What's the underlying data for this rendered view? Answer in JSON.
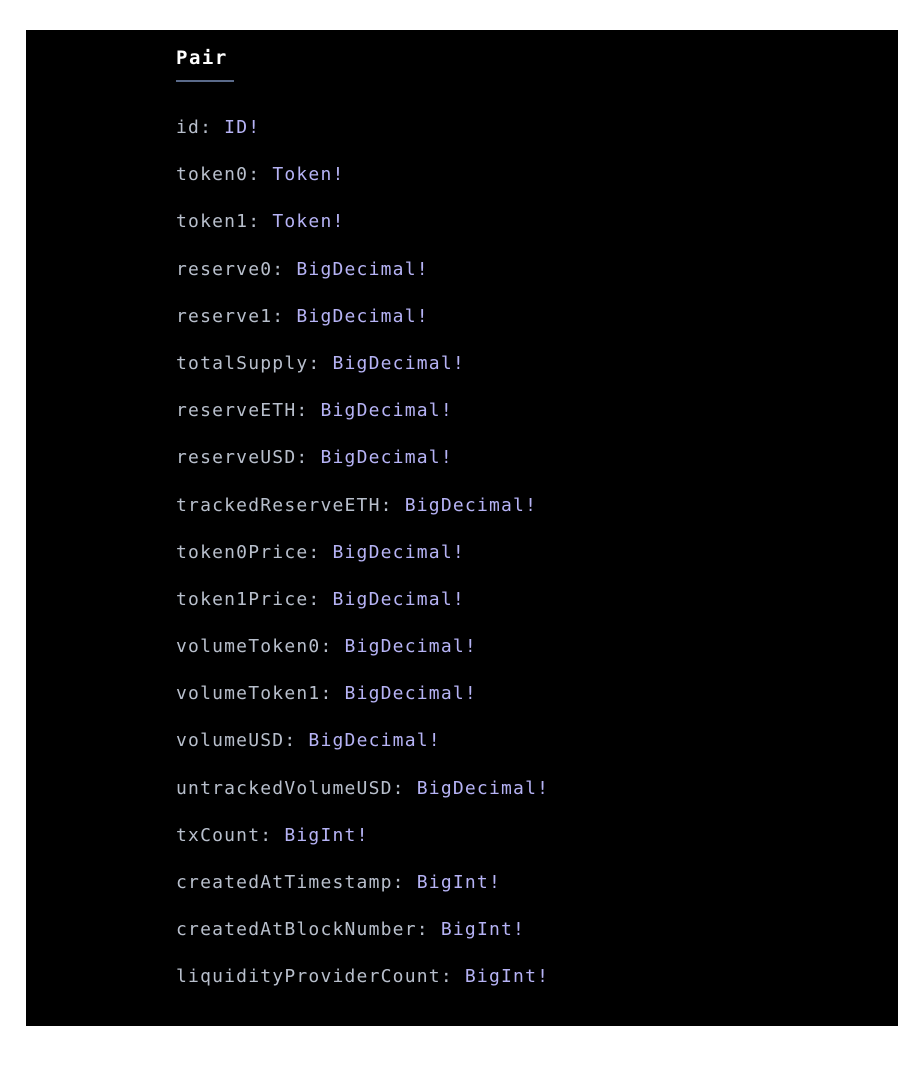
{
  "schema": {
    "title": "Pair",
    "fields": [
      {
        "name": "id",
        "type": "ID!"
      },
      {
        "name": "token0",
        "type": "Token!"
      },
      {
        "name": "token1",
        "type": "Token!"
      },
      {
        "name": "reserve0",
        "type": "BigDecimal!"
      },
      {
        "name": "reserve1",
        "type": "BigDecimal!"
      },
      {
        "name": "totalSupply",
        "type": "BigDecimal!"
      },
      {
        "name": "reserveETH",
        "type": "BigDecimal!"
      },
      {
        "name": "reserveUSD",
        "type": "BigDecimal!"
      },
      {
        "name": "trackedReserveETH",
        "type": "BigDecimal!"
      },
      {
        "name": "token0Price",
        "type": "BigDecimal!"
      },
      {
        "name": "token1Price",
        "type": "BigDecimal!"
      },
      {
        "name": "volumeToken0",
        "type": "BigDecimal!"
      },
      {
        "name": "volumeToken1",
        "type": "BigDecimal!"
      },
      {
        "name": "volumeUSD",
        "type": "BigDecimal!"
      },
      {
        "name": "untrackedVolumeUSD",
        "type": "BigDecimal!"
      },
      {
        "name": "txCount",
        "type": "BigInt!"
      },
      {
        "name": "createdAtTimestamp",
        "type": "BigInt!"
      },
      {
        "name": "createdAtBlockNumber",
        "type": "BigInt!"
      },
      {
        "name": "liquidityProviderCount",
        "type": "BigInt!"
      }
    ]
  },
  "colors": {
    "background": "#000000",
    "title": "#ffffff",
    "field_name": "#b8bfcc",
    "field_type": "#b6b3f5",
    "underline": "#5a6a8a"
  }
}
